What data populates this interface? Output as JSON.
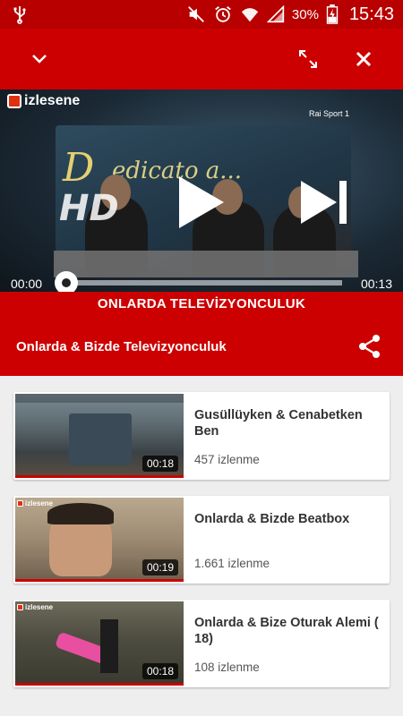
{
  "status_bar": {
    "battery_percent": "30%",
    "time": "15:43"
  },
  "player": {
    "watermark": "izlesene",
    "hd_badge": "HD",
    "channel_bug": "Rai Sport 1",
    "current_time": "00:00",
    "duration": "00:13",
    "progress": 0,
    "caption": "ONLARDA TELEVİZYONCULUK"
  },
  "now_playing": {
    "title": "Onlarda & Bizde Televizyonculuk"
  },
  "related": [
    {
      "title": "Gusüllüyken & Cenabetken Ben",
      "views": "457 izlenme",
      "duration": "00:18"
    },
    {
      "title": "Onlarda & Bizde Beatbox",
      "views": "1.661 izlenme",
      "duration": "00:19"
    },
    {
      "title": "Onlarda & Bize Oturak Alemi ( 18)",
      "views": "108 izlenme",
      "duration": "00:18"
    }
  ],
  "colors": {
    "brand_red": "#cc0000",
    "status_red": "#b80000"
  }
}
